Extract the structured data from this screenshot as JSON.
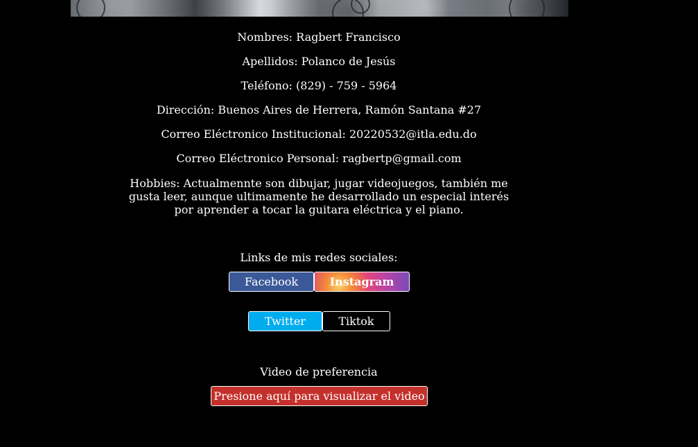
{
  "profile": {
    "nombres": "Nombres: Ragbert Francisco",
    "apellidos": "Apellidos: Polanco de Jesús",
    "telefono": "Teléfono: (829) - 759 - 5964",
    "direccion": "Dirección: Buenos Aires de Herrera, Ramón Santana #27",
    "correo_institucional": "Correo Eléctronico Institucional: 20220532@itla.edu.do",
    "correo_personal": "Correo Eléctronico Personal: ragbertp@gmail.com",
    "hobbies": "Hobbies: Actualmennte son dibujar, jugar videojuegos, también me gusta leer, aunque ultimamente he desarrollado un especial interés por aprender a tocar la guitara eléctrica y el piano."
  },
  "social": {
    "title": "Links de mis redes sociales:",
    "facebook": "Facebook",
    "instagram": "Instagram",
    "twitter": "Twitter",
    "tiktok": "Tiktok"
  },
  "video": {
    "title": "Video de preferencia",
    "button": "Presione aquí para visualizar el video"
  },
  "colors": {
    "background": "#000000",
    "text": "#ffffff",
    "facebook": "#3b5998",
    "twitter": "#00acee",
    "video": "#c4302b"
  }
}
